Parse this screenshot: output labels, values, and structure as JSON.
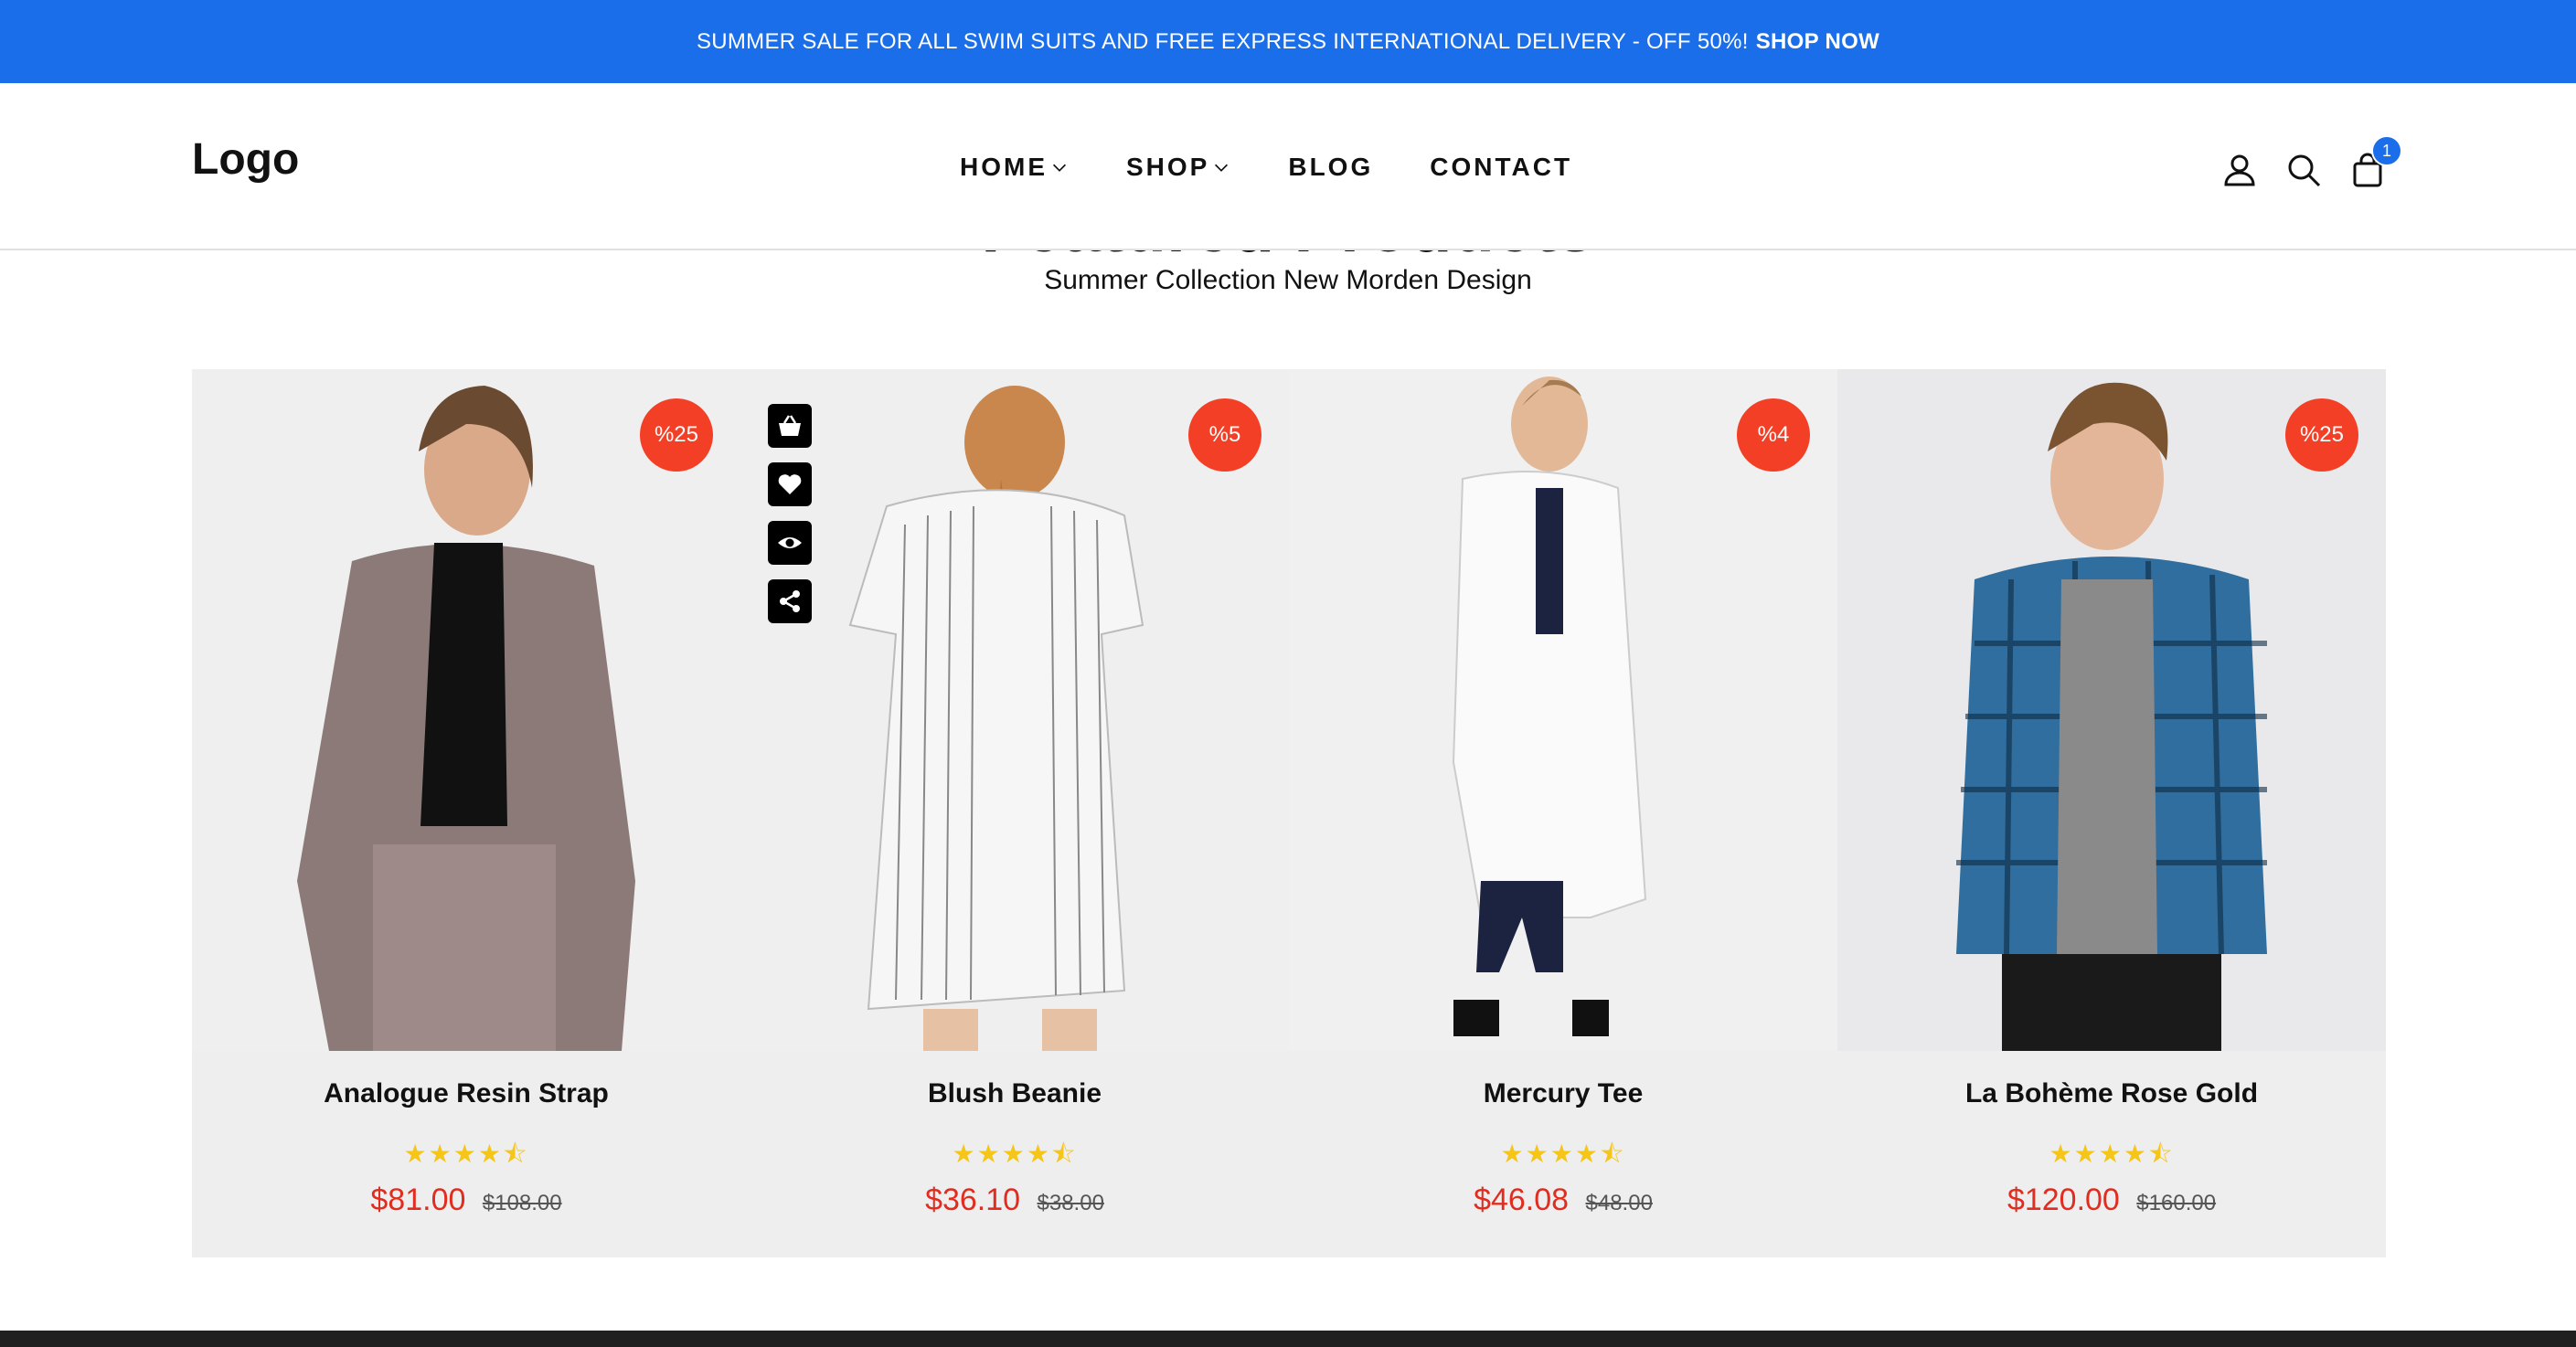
{
  "announcement": {
    "text": "SUMMER SALE FOR ALL SWIM SUITS AND FREE EXPRESS INTERNATIONAL DELIVERY - OFF 50%!",
    "cta": "SHOP NOW",
    "bg_color": "#1a6eea"
  },
  "header": {
    "logo": "Logo",
    "nav": [
      {
        "label": "HOME",
        "dropdown": true
      },
      {
        "label": "SHOP",
        "dropdown": true
      },
      {
        "label": "BLOG",
        "dropdown": false
      },
      {
        "label": "CONTACT",
        "dropdown": false
      }
    ],
    "icons": [
      "user-icon",
      "search-icon",
      "cart-icon"
    ],
    "cart_count": "1"
  },
  "section": {
    "title": "Featured Products",
    "subtitle": "Summer Collection New Morden Design"
  },
  "products": [
    {
      "name": "Analogue Resin Strap",
      "discount": "%25",
      "price": "$81.00",
      "old_price": "$108.00",
      "rating": "4.5",
      "stars": "★★★★⯪"
    },
    {
      "name": "Blush Beanie",
      "discount": "%5",
      "price": "$36.10",
      "old_price": "$38.00",
      "rating": "4.5",
      "stars": "★★★★⯪"
    },
    {
      "name": "Mercury Tee",
      "discount": "%4",
      "price": "$46.08",
      "old_price": "$48.00",
      "rating": "4.5",
      "stars": "★★★★⯪"
    },
    {
      "name": "La Bohème Rose Gold",
      "discount": "%25",
      "price": "$120.00",
      "old_price": "$160.00",
      "rating": "4.5",
      "stars": "★★★★⯪"
    }
  ],
  "hover_actions": [
    "basket-icon",
    "heart-icon",
    "eye-icon",
    "share-icon"
  ],
  "colors": {
    "accent": "#1a6eea",
    "sale": "#f23f26",
    "price": "#e02d20",
    "star": "#f5c518"
  }
}
